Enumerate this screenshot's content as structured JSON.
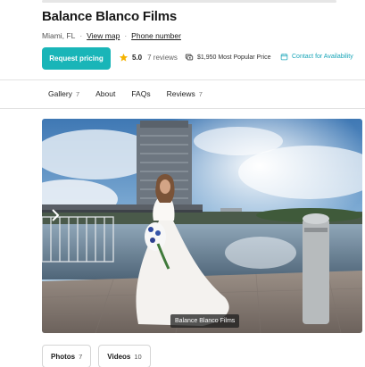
{
  "vendor": {
    "name": "Balance Blanco Films",
    "location": "Miami, FL",
    "separator": "·",
    "view_map": "View map",
    "phone": "Phone number"
  },
  "actions": {
    "request_pricing": "Request pricing",
    "check_availability": "Contact for Availability"
  },
  "rating": {
    "score": "5.0",
    "reviews": "7 reviews"
  },
  "price": {
    "text": "$1,950 Most Popular Price"
  },
  "tabs": [
    {
      "label": "Gallery",
      "count": "7"
    },
    {
      "label": "About",
      "count": ""
    },
    {
      "label": "FAQs",
      "count": ""
    },
    {
      "label": "Reviews",
      "count": "7"
    }
  ],
  "gallery": {
    "caption": "Balance Blanco Films"
  },
  "media": [
    {
      "label": "Photos",
      "count": "7"
    },
    {
      "label": "Videos",
      "count": "10"
    }
  ],
  "icons": {
    "star": "star-icon",
    "price": "price-tag-icon",
    "calendar": "calendar-icon"
  },
  "colors": {
    "accent": "#19b5b8",
    "star": "#f5b301",
    "availability": "#19a5b8"
  }
}
